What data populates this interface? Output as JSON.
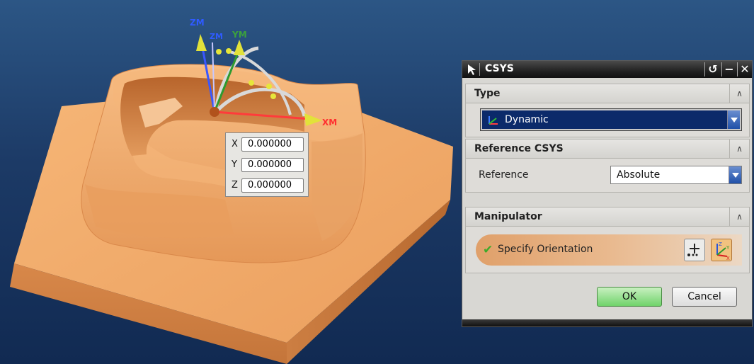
{
  "viewport": {
    "axis_labels": {
      "zm": "ZM",
      "zm_inner": "ZM",
      "ym": "YM",
      "xm": "XM"
    },
    "coords": [
      {
        "axis": "X",
        "value": "0.000000"
      },
      {
        "axis": "Y",
        "value": "0.000000"
      },
      {
        "axis": "Z",
        "value": "0.000000"
      }
    ],
    "colors": {
      "part": "#f1a766",
      "background_top": "#2c5685",
      "background_bottom": "#112a52"
    }
  },
  "dialog": {
    "title": "CSYS",
    "titlebar_buttons": {
      "reset": "↺",
      "minimize": "−",
      "close": "✕"
    },
    "groups": {
      "type": {
        "title": "Type",
        "selected": "Dynamic",
        "toggle": "∧"
      },
      "reference": {
        "title": "Reference CSYS",
        "label": "Reference",
        "selected": "Absolute",
        "toggle": "∧"
      },
      "manipulator": {
        "title": "Manipulator",
        "item": "Specify Orientation",
        "toggle": "∧"
      }
    },
    "buttons": {
      "ok": "OK",
      "cancel": "Cancel"
    }
  }
}
